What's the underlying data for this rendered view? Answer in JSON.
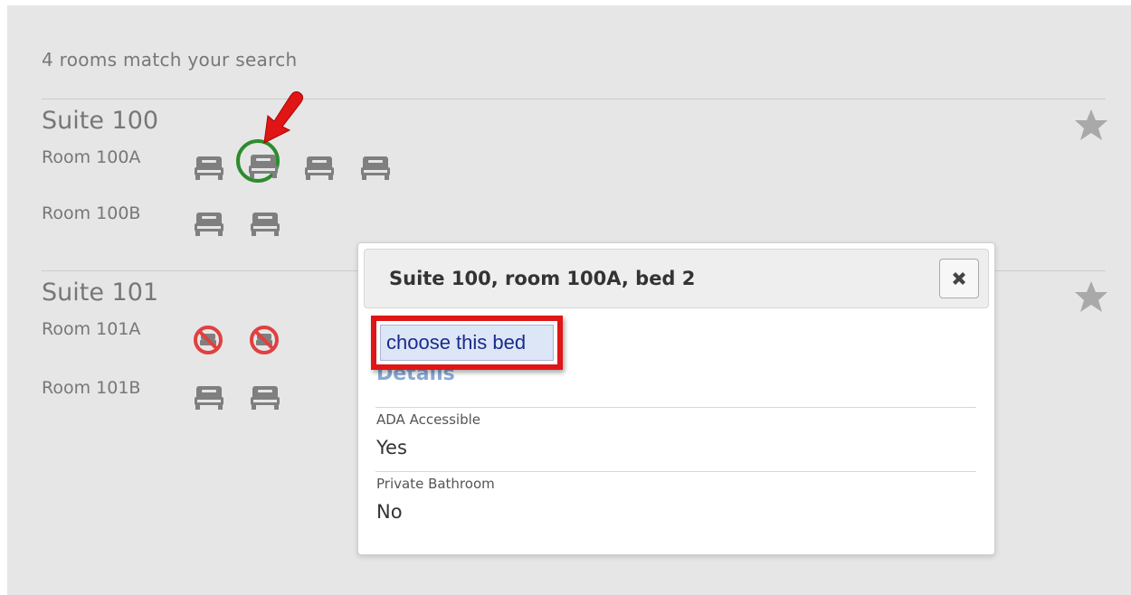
{
  "results": {
    "count_text": "4 rooms match your search"
  },
  "suites": [
    {
      "title": "Suite 100",
      "rooms": [
        {
          "label": "Room 100A",
          "beds": [
            "available",
            "selected",
            "available",
            "available"
          ]
        },
        {
          "label": "Room 100B",
          "beds": [
            "available",
            "available"
          ]
        }
      ]
    },
    {
      "title": "Suite 101",
      "rooms": [
        {
          "label": "Room 101A",
          "beds": [
            "unavailable",
            "unavailable"
          ]
        },
        {
          "label": "Room 101B",
          "beds": [
            "available",
            "available"
          ]
        }
      ]
    }
  ],
  "popup": {
    "title": "Suite 100, room 100A, bed 2",
    "choose_label": "choose this bed",
    "details_heading": "Details",
    "properties": [
      {
        "label": "ADA Accessible",
        "value": "Yes"
      },
      {
        "label": "Private Bathroom",
        "value": "No"
      }
    ]
  },
  "colors": {
    "selected_ring": "#2e8b2e",
    "unavailable": "#e04040",
    "highlight_box": "#e01515",
    "arrow": "#e01515"
  },
  "icons": {
    "bed": "bed-icon",
    "unavailable_bed": "unavailable-bed-icon",
    "favorite": "star-icon",
    "close": "close-icon",
    "annotation": "red-arrow-icon"
  }
}
